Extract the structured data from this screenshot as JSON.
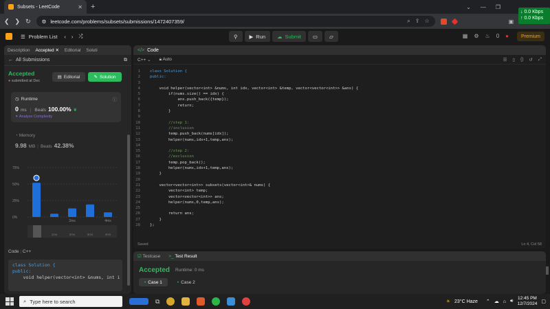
{
  "browser": {
    "tab_title": "Subsets - LeetCode",
    "url": "leetcode.com/problems/subsets/submissions/1472407359/",
    "net_up": "↓ 0.0 Kbps",
    "net_down": "↑ 0.0 Kbps"
  },
  "header": {
    "problem_list": "Problem List",
    "run": "Run",
    "submit": "Submit",
    "streak": "0",
    "premium": "Premium"
  },
  "left": {
    "tabs": [
      "Description",
      "Accepted",
      "Editorial",
      "Soluti"
    ],
    "all_submissions": "All Submissions",
    "status": "Accepted",
    "submitted": "submitted at Dec",
    "editorial_btn": "Editorial",
    "solution_btn": "Solution",
    "runtime_label": "Runtime",
    "runtime_value": "0",
    "runtime_unit": "ms",
    "beats_label": "Beats",
    "beats_value": "100.00%",
    "analyze": "Analyze Complexity",
    "memory_label": "Memory",
    "memory_value": "9.98",
    "memory_unit": "MB",
    "memory_beats_label": "Beats",
    "memory_beats": "42.38%",
    "code_label": "Code",
    "code_lang": "C++",
    "code_preview": [
      "class Solution {",
      "public:",
      "    void helper(vector<int> &nums, int i"
    ]
  },
  "chart_data": {
    "type": "bar",
    "y_ticks": [
      "75%",
      "50%",
      "25%",
      "0%"
    ],
    "ylim": [
      0,
      75
    ],
    "values": [
      52,
      5,
      13,
      19,
      7
    ],
    "x_ticks_top": [
      "",
      "",
      "2ms",
      "",
      "4ms"
    ],
    "x_ticks_bottom": [
      "",
      "1ms",
      "2ms",
      "3ms",
      "4ms"
    ]
  },
  "editor": {
    "title": "Code",
    "lang": "C++",
    "mode": "Auto",
    "status_left": "Saved",
    "status_right": "Ln 4, Col 58",
    "lines": [
      "class Solution {",
      "public:",
      "",
      "    void helper(vector<int> &nums, int idx, vector<int> &temp, vector<vector<int>> &ans) {",
      "        if(nums.size() == idx) {",
      "            ans.push_back({temp});",
      "            return;",
      "        }",
      "",
      "        //step 1:",
      "        //inclusion",
      "        temp.push_back(nums[idx]);",
      "        helper(nums,idx+1,temp,ans);",
      "",
      "        //step 2:",
      "        //exclusion",
      "        temp.pop_back();",
      "        helper(nums,idx+1,temp,ans);",
      "    }",
      "",
      "    vector<vector<int>> subsets(vector<int>& nums) {",
      "        vector<int> temp;",
      "        vector<vector<int>> ans;",
      "        helper(nums,0,temp,ans);",
      "",
      "        return ans;",
      "    }",
      "};"
    ]
  },
  "result": {
    "tab_testcase": "Testcase",
    "tab_result": "Test Result",
    "status": "Accepted",
    "runtime": "Runtime: 0 ms",
    "cases": [
      "Case 1",
      "Case 2"
    ]
  },
  "taskbar": {
    "search_placeholder": "Type here to search",
    "weather": "23°C  Haze",
    "time": "12:45 PM",
    "date": "12/7/2024"
  }
}
